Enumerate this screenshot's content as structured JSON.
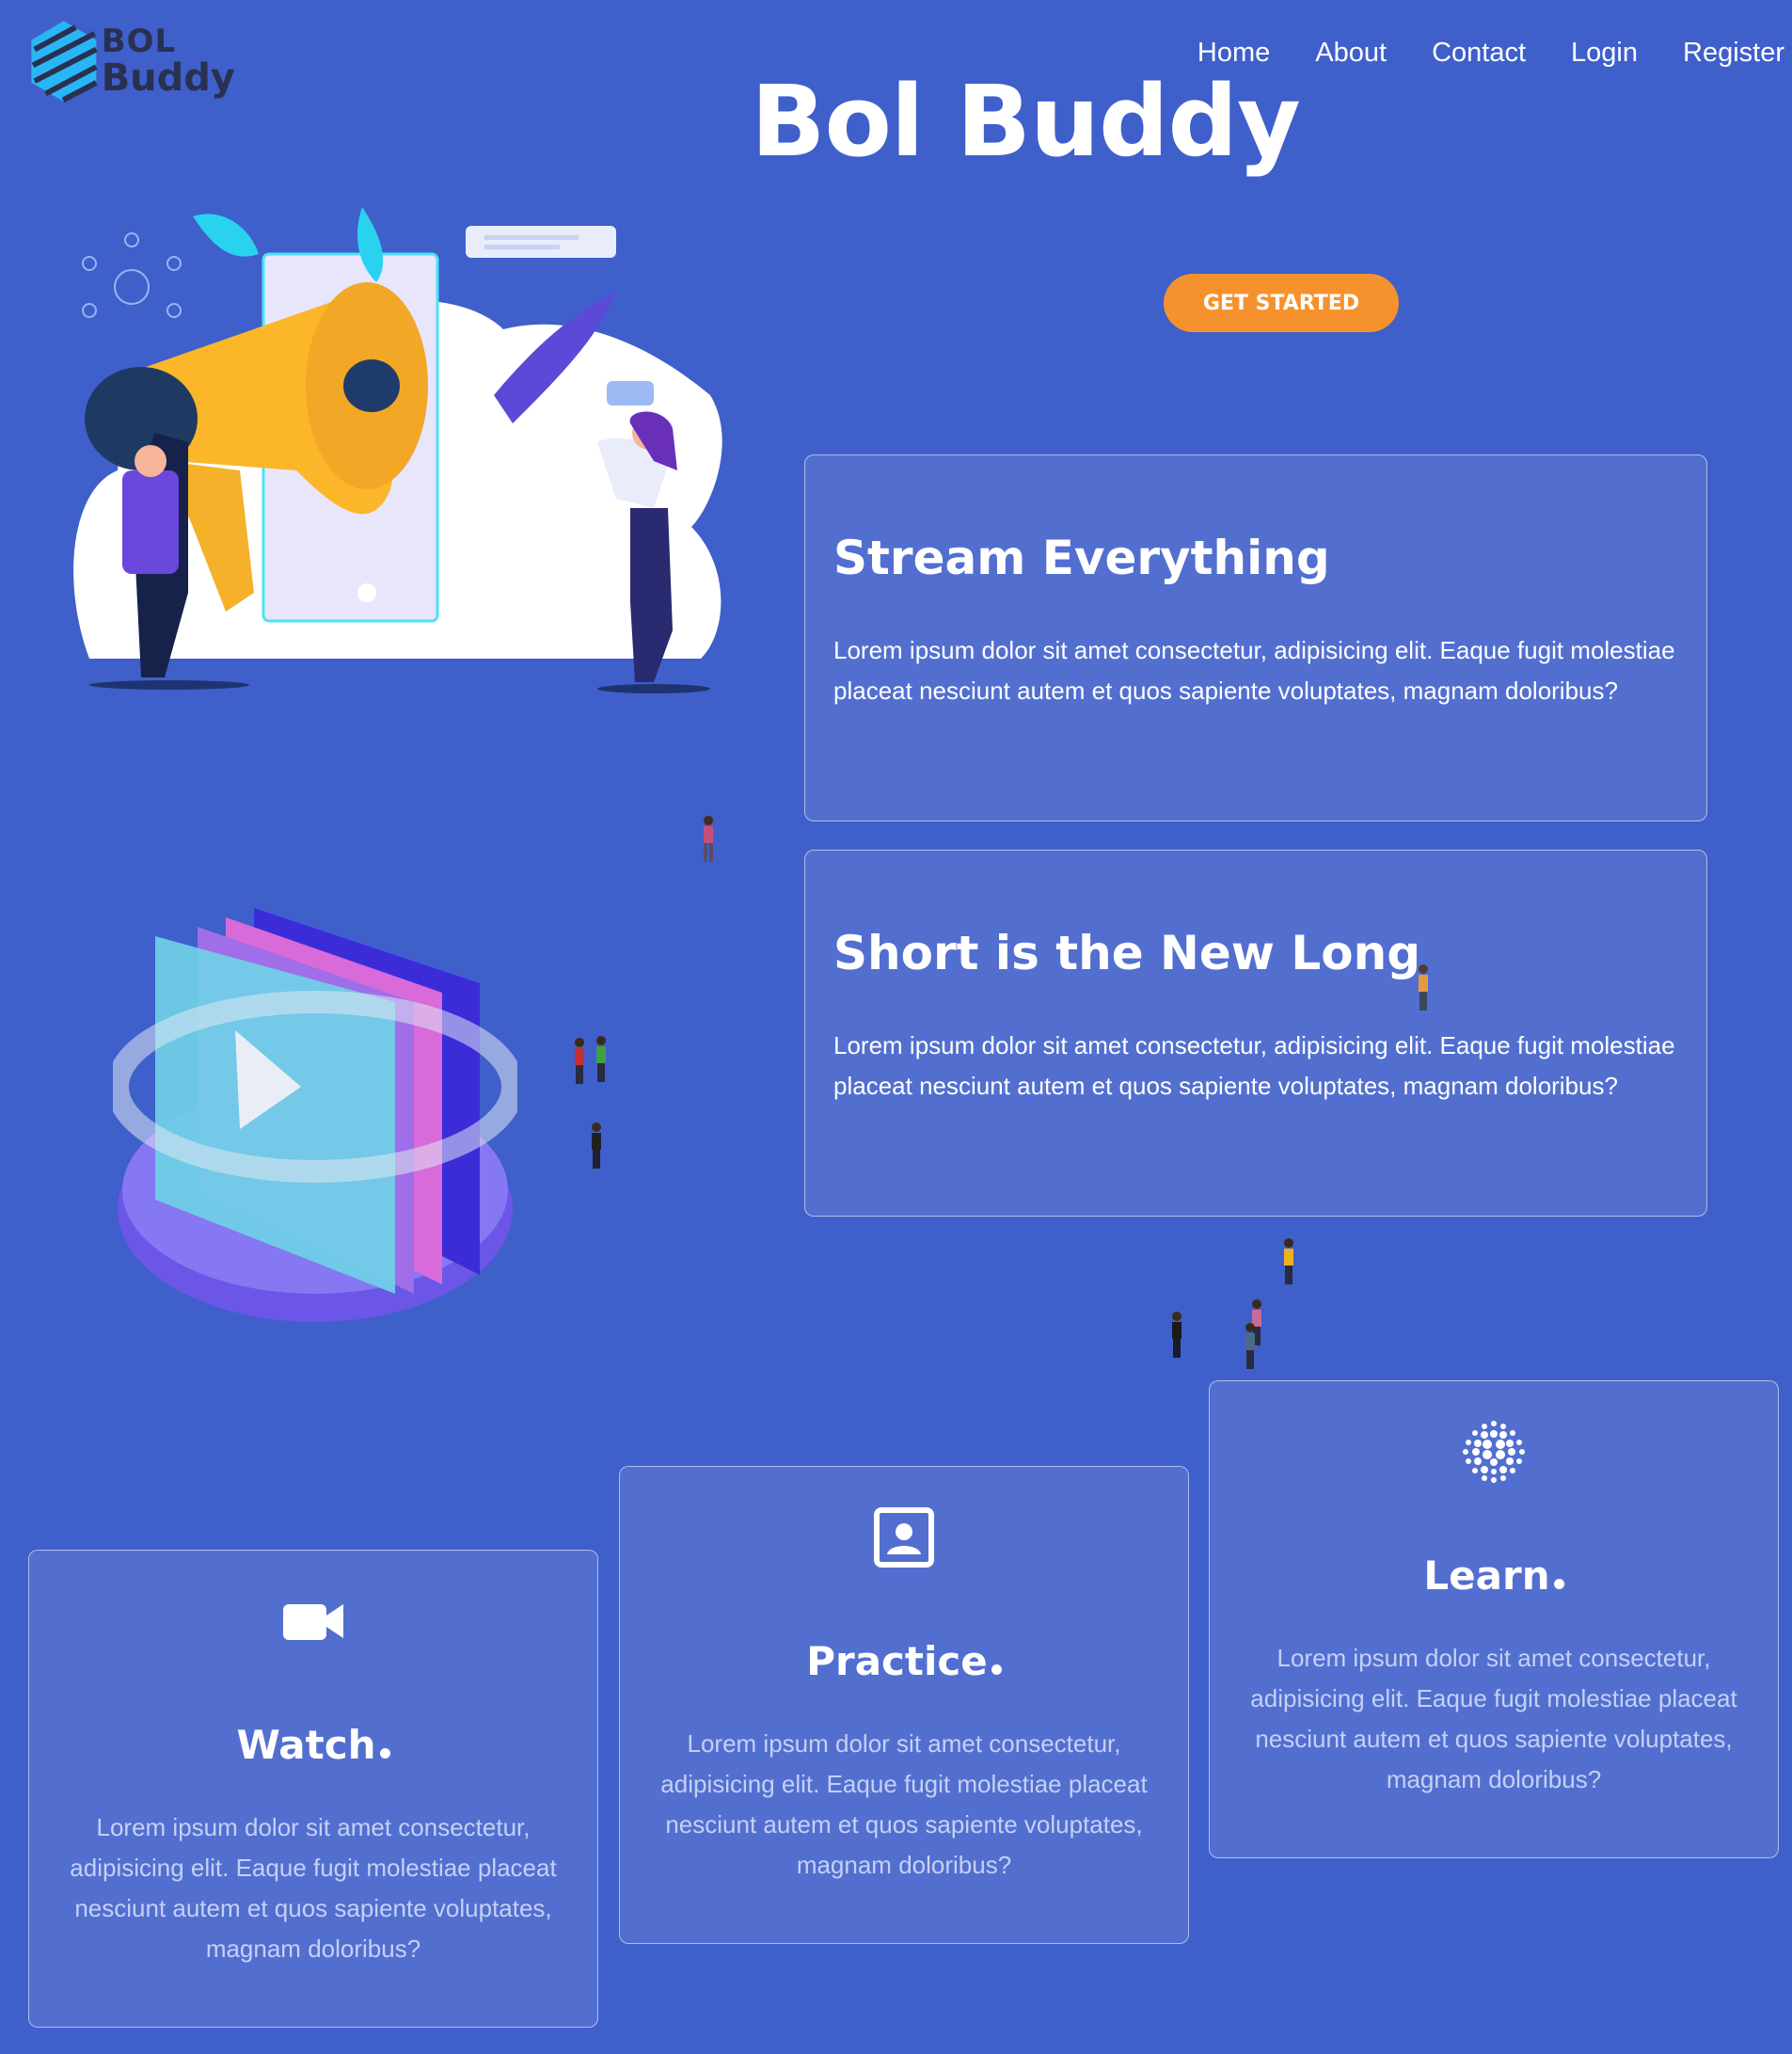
{
  "logo": {
    "line1": "BOL",
    "line2": "Buddy"
  },
  "nav": {
    "items": [
      "Home",
      "About",
      "Contact",
      "Login",
      "Register"
    ]
  },
  "hero": {
    "title": "Bol Buddy",
    "cta_label": "GET STARTED"
  },
  "features": [
    {
      "title": "Stream Everything",
      "text": "Lorem ipsum dolor sit amet consectetur, adipisicing elit. Eaque fugit molestiae placeat nesciunt autem et quos sapiente voluptates, magnam doloribus?"
    },
    {
      "title": "Short is the New Long",
      "text": "Lorem ipsum dolor sit amet consectetur, adipisicing elit. Eaque fugit molestiae placeat nesciunt autem et quos sapiente voluptates, magnam doloribus?"
    }
  ],
  "cards": [
    {
      "icon": "video-camera-icon",
      "title": "Watch",
      "text": "Lorem ipsum dolor sit amet consectetur, adipisicing elit. Eaque fugit molestiae placeat nesciunt autem et quos sapiente voluptates, magnam doloribus?"
    },
    {
      "icon": "user-portrait-icon",
      "title": "Practice",
      "text": "Lorem ipsum dolor sit amet consectetur, adipisicing elit. Eaque fugit molestiae placeat nesciunt autem et quos sapiente voluptates, magnam doloribus?"
    },
    {
      "icon": "dot-grid-icon",
      "title": "Learn",
      "text": "Lorem ipsum dolor sit amet consectetur, adipisicing elit. Eaque fugit molestiae placeat nesciunt autem et quos sapiente voluptates, magnam doloribus?"
    }
  ],
  "colors": {
    "background": "#3f5fcb",
    "accent": "#f5922e",
    "card_text": "#c5d0f5"
  }
}
